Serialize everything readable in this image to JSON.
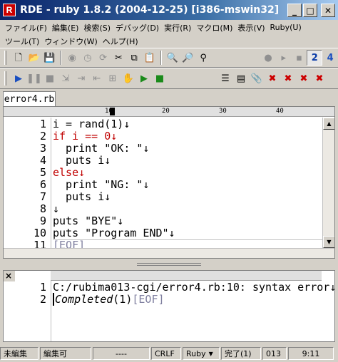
{
  "window": {
    "icon_letter": "R",
    "title": "RDE - ruby 1.8.2 (2004-12-25) [i386-mswin32]",
    "minimize_glyph": "_",
    "maximize_glyph": "□",
    "close_glyph": "✕"
  },
  "menu": {
    "row1": [
      "ファイル(F)",
      "編集(E)",
      "検索(S)",
      "デバッグ(D)",
      "実行(R)",
      "マクロ(M)",
      "表示(V)",
      "Ruby(U)"
    ],
    "row2": [
      "ツール(T)",
      "ウィンドウ(W)",
      "ヘルプ(H)"
    ]
  },
  "toolbar2_right": {
    "btn2": "2",
    "btn4": "4"
  },
  "editor": {
    "tab_label": "error4.rb",
    "ruler_marks": [
      "10",
      "20",
      "30",
      "40"
    ],
    "line_numbers": [
      "1",
      "2",
      "3",
      "4",
      "5",
      "6",
      "7",
      "8",
      "9",
      "10",
      "11"
    ],
    "lines": [
      "i = rand(1)↓",
      "if i == 0↓",
      "  print \"OK: \"↓",
      "  puts i↓",
      "else↓",
      "  print \"NG: \"↓",
      "  puts i↓",
      "↓",
      "puts \"BYE\"↓",
      "puts \"Program END\"↓",
      "[EOF]"
    ]
  },
  "output": {
    "close_glyph": "×",
    "line_numbers": [
      "1",
      "2"
    ],
    "line1": "C:/rubima013-cgi/error4.rb:10: syntax error↓",
    "line2_completed": "Completed",
    "line2_rest": "(1)",
    "line2_eof": "[EOF]"
  },
  "status": {
    "mode": "未編集",
    "editable": "編集可",
    "dashes": "----",
    "newline": "CRLF",
    "language": "Ruby",
    "completion": "完了(1)",
    "code": "013",
    "position": "9:11"
  }
}
